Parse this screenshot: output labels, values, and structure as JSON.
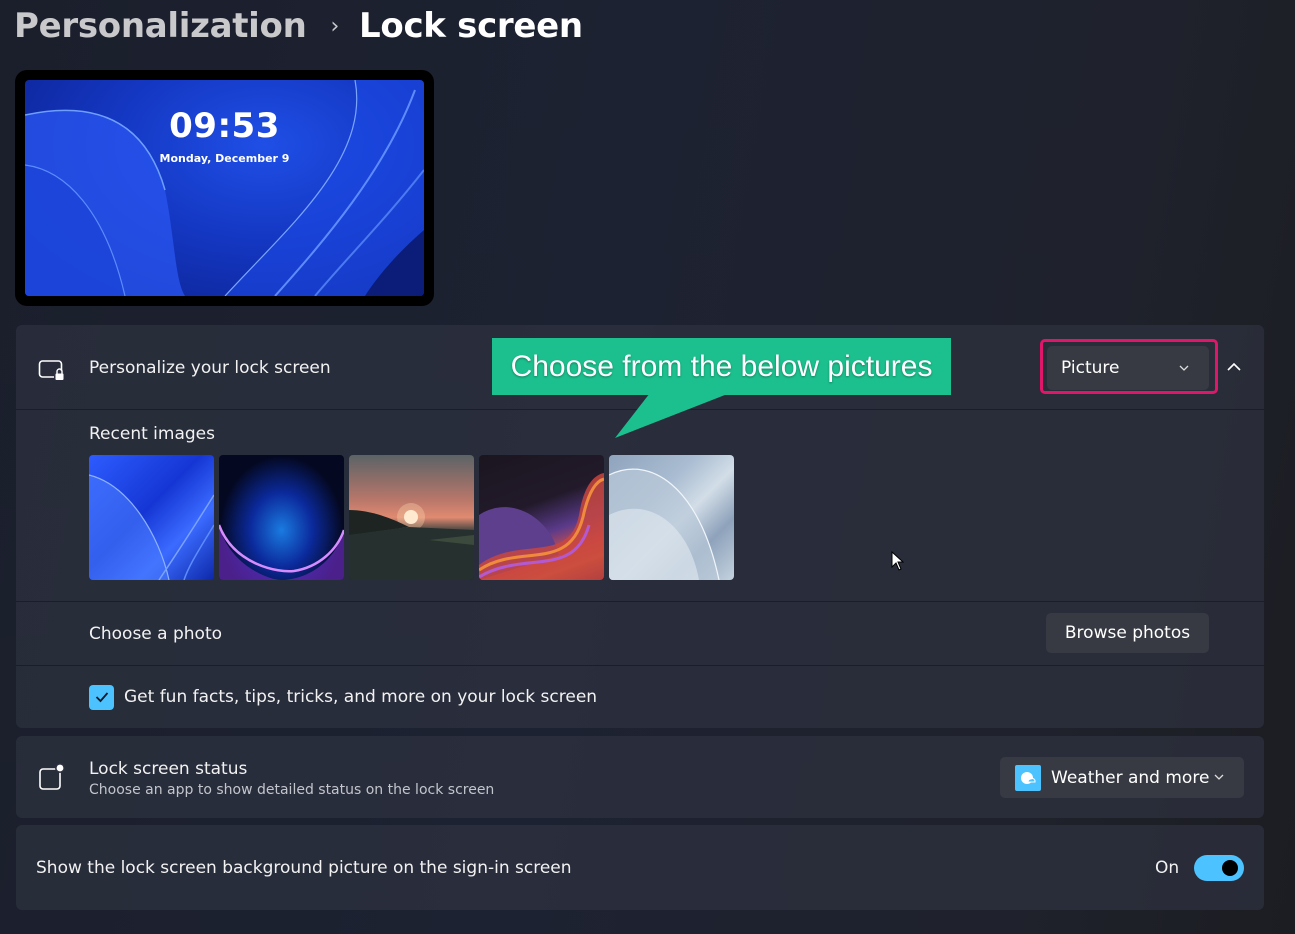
{
  "breadcrumb": {
    "parent": "Personalization",
    "separator": "›",
    "current": "Lock screen"
  },
  "preview": {
    "time": "09:53",
    "date": "Monday, December 9"
  },
  "personalize": {
    "icon": "lock-screen-icon",
    "title": "Personalize your lock screen",
    "dropdown_value": "Picture",
    "expanded": true,
    "recent_images_label": "Recent images",
    "recent_images": [
      {
        "name": "windows-bloom-blue"
      },
      {
        "name": "blue-purple-orb"
      },
      {
        "name": "sunset-lake"
      },
      {
        "name": "colorful-ribbon"
      },
      {
        "name": "light-blue-bloom"
      }
    ],
    "choose_photo_label": "Choose a photo",
    "browse_button": "Browse photos",
    "fun_facts_label": "Get fun facts, tips, tricks, and more on your lock screen",
    "fun_facts_checked": true
  },
  "callout": {
    "text": "Choose from the below pictures",
    "color": "#1cc08e"
  },
  "highlight_color": "#e0166b",
  "status": {
    "icon": "app-status-icon",
    "title": "Lock screen status",
    "subtitle": "Choose an app to show detailed status on the lock screen",
    "dropdown_value": "Weather and more"
  },
  "signin": {
    "title": "Show the lock screen background picture on the sign-in screen",
    "toggle_label": "On",
    "toggle_on": true
  },
  "accent_color": "#4cc2ff"
}
